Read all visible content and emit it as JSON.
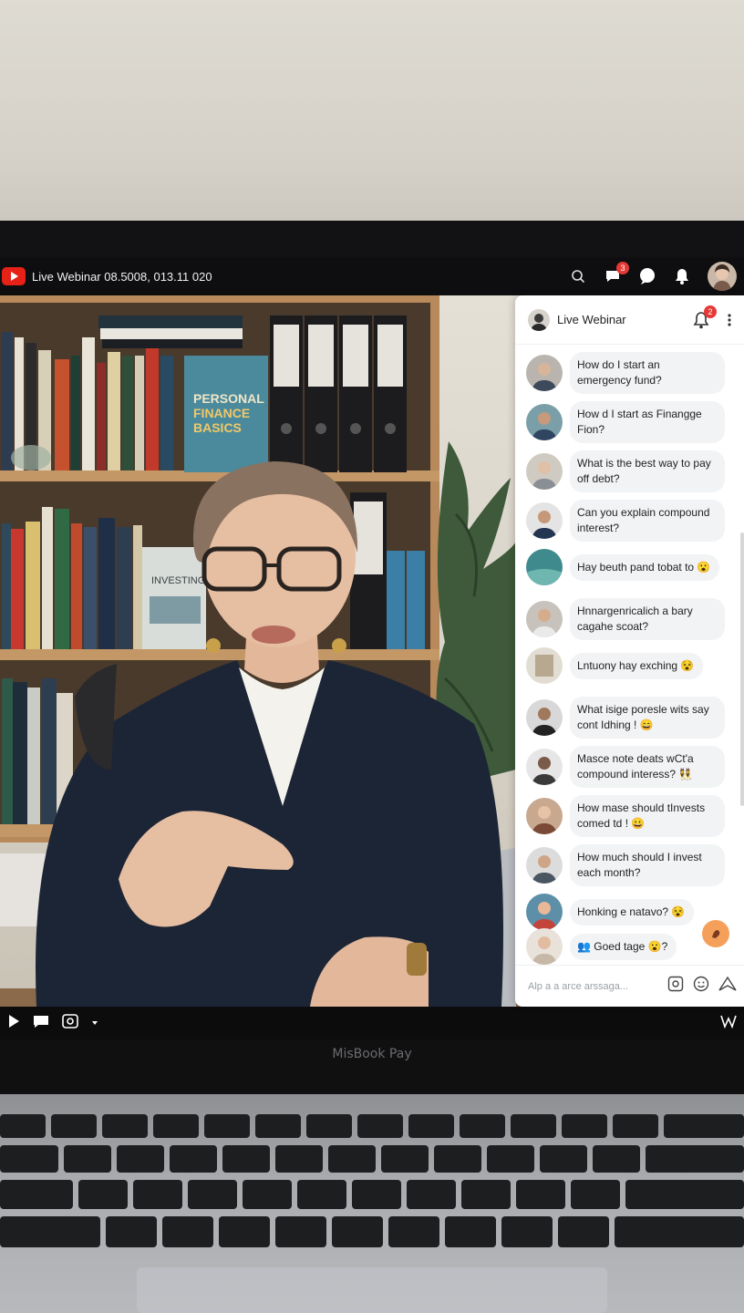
{
  "topbar": {
    "title": "Live Webinar 08.5008, 013.11 020",
    "notification_count": "3"
  },
  "video": {
    "book_title": "PERSONAL FINANCE BASICS",
    "book_title_2": "INVESTING"
  },
  "chat": {
    "title": "Live Webinar",
    "bell_count": "2",
    "messages": [
      {
        "text": "How do I start an emergency fund?"
      },
      {
        "text": "How d I start as Finangge Fion?"
      },
      {
        "text": "What is the best way to pay off debt?"
      },
      {
        "text": "Can you explain compound interest?"
      },
      {
        "text": "Hay beuth pand tobat to 😮"
      },
      {
        "text": "Hnnargenricalich a bary cagahe scoat?"
      },
      {
        "text": "Lntuony hay exching 😵"
      },
      {
        "text": "What isige poresle wits say cont Idhing ! 😄"
      },
      {
        "text": "Masce note deats wCt'a compound interess? 👯"
      },
      {
        "text": "How mase should tInvests comed td ! 😀"
      },
      {
        "text": "How much should I invest each month?"
      },
      {
        "text": "Honking e natavo? 😵"
      },
      {
        "text": "👥 Goed tage 😮?"
      }
    ],
    "composer_placeholder": "Alp a a arce arssaga..."
  },
  "laptop": {
    "brand": "MisBook Pay"
  },
  "colors": {
    "accent_red": "#e62117",
    "fab_orange": "#f5a05a",
    "bubble_bg": "#f1f3f4"
  }
}
